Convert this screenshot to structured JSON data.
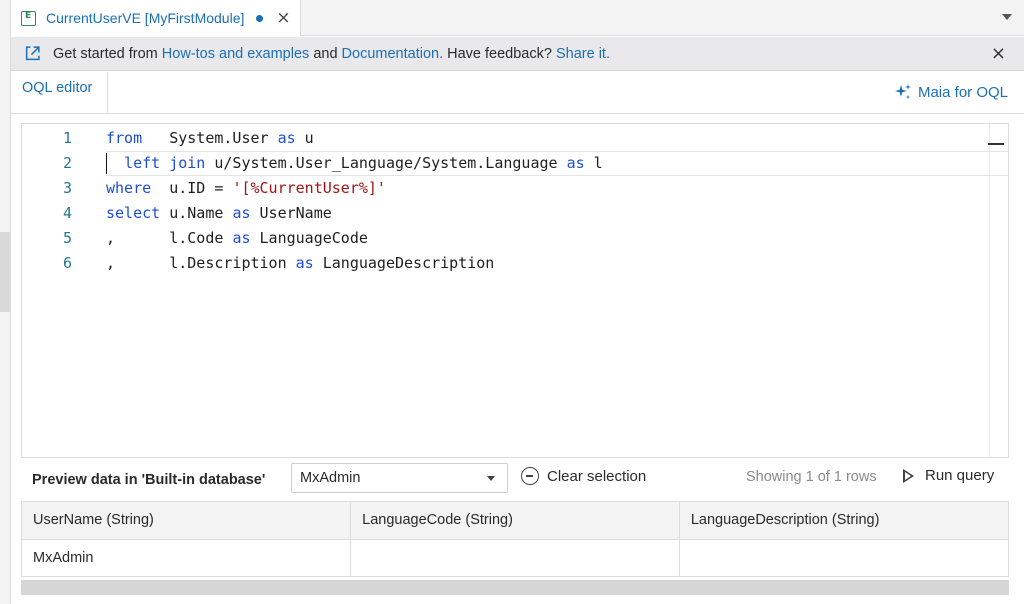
{
  "tab": {
    "title": "CurrentUserVE [MyFirstModule]",
    "icon": "entity-icon",
    "close": "×"
  },
  "infobar": {
    "prefix": "Get started from ",
    "link1": "How-tos and examples",
    "and": " and ",
    "link2": "Documentation.",
    "feedback": " Have feedback? ",
    "link3": "Share it.",
    "close": "×"
  },
  "editor": {
    "tab_label": "OQL editor",
    "maia_label": "Maia for OQL",
    "lines": [
      {
        "num": "1",
        "tokens": [
          [
            "kw",
            "from"
          ],
          [
            "t",
            "   System.User "
          ],
          [
            "kw",
            "as"
          ],
          [
            "t",
            " u"
          ]
        ]
      },
      {
        "num": "2",
        "tokens": [
          [
            "t",
            "  "
          ],
          [
            "kw",
            "left"
          ],
          [
            "t",
            " "
          ],
          [
            "kw",
            "join"
          ],
          [
            "t",
            " u/System.User_Language/System.Language "
          ],
          [
            "kw",
            "as"
          ],
          [
            "t",
            " l"
          ]
        ]
      },
      {
        "num": "3",
        "tokens": [
          [
            "kw",
            "where"
          ],
          [
            "t",
            "  u.ID = "
          ],
          [
            "str",
            "'[%CurrentUser%]'"
          ]
        ]
      },
      {
        "num": "4",
        "tokens": [
          [
            "kw",
            "select"
          ],
          [
            "t",
            " u.Name "
          ],
          [
            "kw",
            "as"
          ],
          [
            "t",
            " UserName"
          ]
        ]
      },
      {
        "num": "5",
        "tokens": [
          [
            "t",
            ",      l.Code "
          ],
          [
            "kw",
            "as"
          ],
          [
            "t",
            " LanguageCode"
          ]
        ]
      },
      {
        "num": "6",
        "tokens": [
          [
            "t",
            ",      l.Description "
          ],
          [
            "kw",
            "as"
          ],
          [
            "t",
            " LanguageDescription"
          ]
        ]
      }
    ]
  },
  "preview": {
    "label": "Preview data in 'Built-in database'",
    "selected_user": "MxAdmin",
    "clear_label": "Clear selection",
    "showing": "Showing 1 of 1 rows",
    "run_label": "Run query"
  },
  "results": {
    "columns": [
      "UserName (String)",
      "LanguageCode (String)",
      "LanguageDescription (String)"
    ],
    "rows": [
      [
        "MxAdmin",
        "",
        ""
      ]
    ]
  },
  "colors": {
    "accent": "#1b6fb8",
    "keyword": "#1d4ed8",
    "string": "#a31515",
    "line_number": "#237893",
    "modified_dot": "#1b6fb8"
  }
}
